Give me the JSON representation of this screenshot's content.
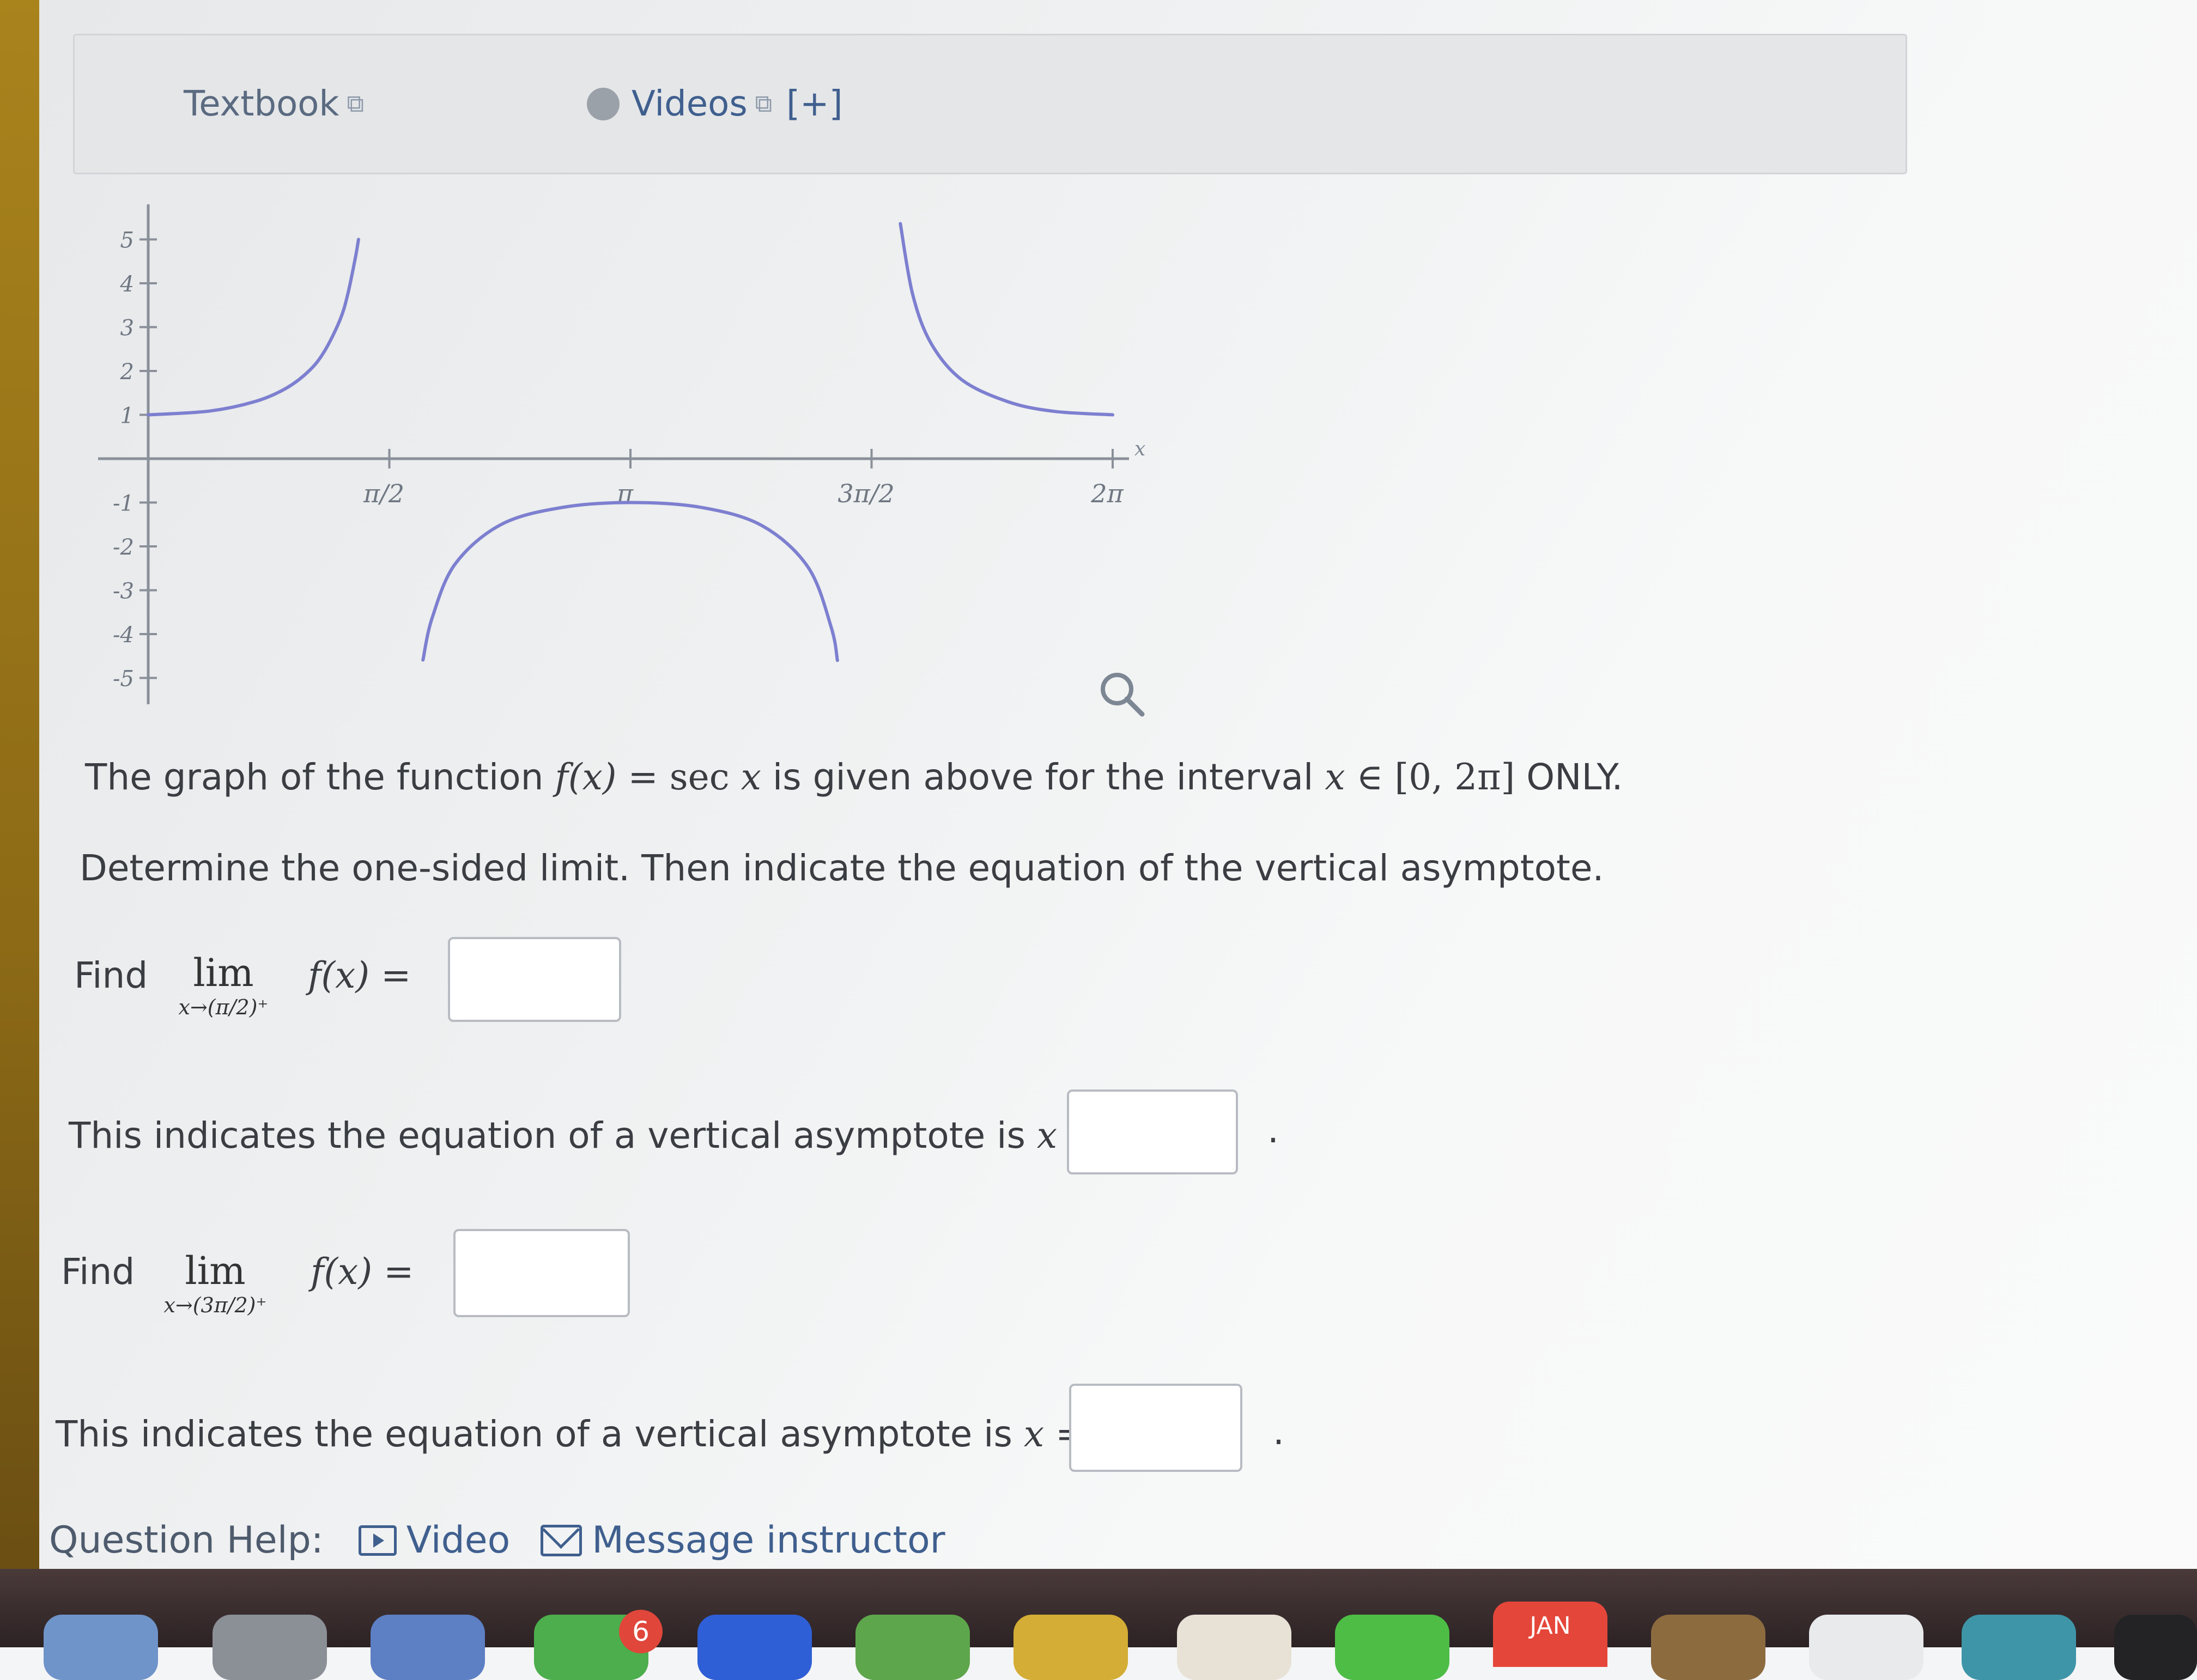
{
  "resources": {
    "textbook_label": "Textbook",
    "videos_label": "Videos",
    "videos_expand": "[+]"
  },
  "chart_data": {
    "type": "line",
    "function": "sec x",
    "x_tick_labels": [
      "π/2",
      "π",
      "3π/2",
      "2π"
    ],
    "x_ticks": [
      1.5708,
      3.1416,
      4.7124,
      6.2832
    ],
    "x_axis_label": "x",
    "y_tick_labels": [
      "5",
      "4",
      "3",
      "2",
      "1",
      "-1",
      "-2",
      "-3",
      "-4",
      "-5"
    ],
    "y_ticks": [
      5,
      4,
      3,
      2,
      1,
      -1,
      -2,
      -3,
      -4,
      -5
    ],
    "xlim": [
      0,
      6.2832
    ],
    "ylim": [
      -5.6,
      5.8
    ],
    "series": [
      {
        "x": [
          0,
          0.4,
          0.7,
          0.9,
          1.05,
          1.15,
          1.25,
          1.3,
          1.35,
          1.37
        ],
        "y": [
          1,
          1.086,
          1.307,
          1.609,
          2.01,
          2.46,
          3.17,
          3.75,
          4.59,
          5.0
        ]
      },
      {
        "x": [
          1.79,
          1.85,
          2.0,
          2.3,
          2.7,
          3.1416,
          3.6,
          4.0,
          4.3,
          4.45,
          4.49
        ],
        "y": [
          -4.59,
          -3.63,
          -2.4,
          -1.5,
          -1.11,
          -1,
          -1.11,
          -1.53,
          -2.48,
          -3.85,
          -4.6
        ]
      },
      {
        "x": [
          4.9,
          4.98,
          5.1,
          5.3,
          5.6,
          5.9,
          6.2832
        ],
        "y": [
          5.36,
          3.75,
          2.63,
          1.8,
          1.3,
          1.08,
          1
        ]
      }
    ]
  },
  "question": {
    "line1_prefix": "The graph of the function",
    "line1_fx": "f(x)",
    "line1_eq": "= sec",
    "line1_x": "x",
    "line1_mid": "is given above for the interval",
    "line1_x2": "x",
    "line1_in": "∈",
    "line1_interval": "[0, 2π]",
    "line1_suffix": "ONLY.",
    "line2": "Determine the one-sided limit. Then indicate the equation of the vertical asymptote.",
    "find_label": "Find",
    "lim_word": "lim",
    "limit1_sub": "x→(π/2)⁺",
    "limit2_sub": "x→(3π/2)⁺",
    "fx_eq": "f(x) =",
    "asymptote_text": "This indicates the equation of a vertical asymptote is",
    "asymptote_var": "x =",
    "period": "."
  },
  "answers": {
    "limit1": "",
    "asymptote1": "",
    "limit2": "",
    "asymptote2": ""
  },
  "help": {
    "label": "Question Help:",
    "video_label": "Video",
    "message_label": "Message instructor"
  },
  "dock": {
    "badge_count": "6",
    "calendar_month": "JAN"
  }
}
